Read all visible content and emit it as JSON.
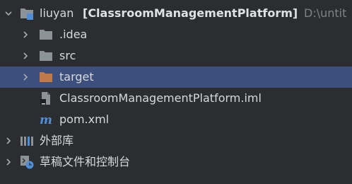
{
  "project_tree": {
    "root": {
      "name": "liuyan",
      "module": "[ClassroomManagementPlatform]",
      "path": "D:\\untit",
      "icon": "module-folder-icon"
    },
    "items": [
      {
        "label": ".idea",
        "icon": "folder-icon"
      },
      {
        "label": "src",
        "icon": "folder-icon"
      },
      {
        "label": "target",
        "icon": "excluded-folder-icon",
        "selected": true
      },
      {
        "label": "ClassroomManagementPlatform.iml",
        "icon": "iml-file-icon"
      },
      {
        "label": "pom.xml",
        "icon": "maven-icon"
      }
    ],
    "external_libraries": {
      "label": "外部库",
      "icon": "libraries-icon"
    },
    "scratches": {
      "label": "草稿文件和控制台",
      "icon": "scratches-icon"
    }
  },
  "colors": {
    "background": "#2b2d30",
    "selection": "#3d4f7d",
    "folder": "#8c9398",
    "excluded_folder": "#c07a4a",
    "maven": "#4e8fd8",
    "path_text": "#7f8286"
  }
}
